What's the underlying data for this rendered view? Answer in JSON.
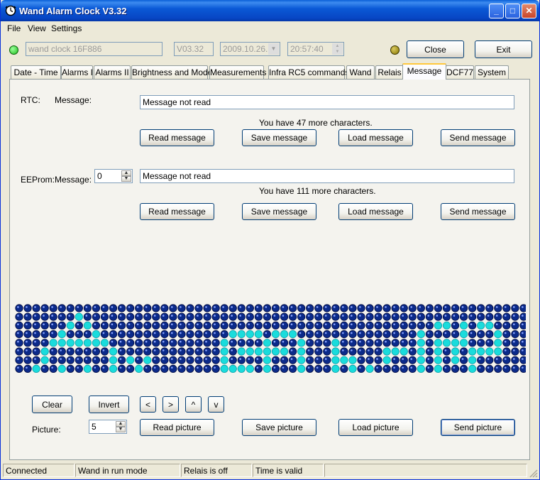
{
  "window": {
    "title": "Wand Alarm Clock V3.32",
    "minimize": "_",
    "maximize": "□",
    "close": "✕"
  },
  "menu": [
    "File",
    "View",
    "Settings"
  ],
  "top": {
    "device_name": "wand clock 16F886",
    "version": "V03.32",
    "date": "2009.10.26.",
    "time": "20:57:40",
    "close_label": "Close",
    "exit_label": "Exit",
    "led_left_color": "#1ec01e",
    "led_right_color": "#8a7a00"
  },
  "tabs": [
    "Date - Time",
    "Alarms I",
    "Alarms II",
    "Brightness and Mode",
    "Measurements",
    "Infra RC5 commands",
    "Wand",
    "Relais",
    "Message",
    "DCF77",
    "System"
  ],
  "active_tab": "Message",
  "rtc": {
    "label": "RTC:",
    "message_label": "Message:",
    "message": "Message not read",
    "chars_left": "You have 47 more characters.",
    "buttons": [
      "Read message",
      "Save message",
      "Load message",
      "Send message"
    ]
  },
  "eeprom": {
    "label": "EEProm:",
    "message_label": "Message:",
    "index": "0",
    "message": "Message not read",
    "chars_left": "You have 111 more characters.",
    "buttons": [
      "Read message",
      "Save message",
      "Load message",
      "Send message"
    ]
  },
  "matrix": {
    "cols": 60,
    "rows": 8,
    "on_color": "#19dcdc",
    "off_color": "#0b2a8a",
    "rows_on": [
      "........................................................................",
      ".......#....................................................",
      "......#.#........................................##.#.##....",
      ".....#...#...............####.###..............#....#...#...",
      "....#######.............#....#...#...#.........#.####...#...",
      "...#.......#............#.######.#...#.....###.#.#.#.####...",
      "...#.......#.#.#........#....#...#...###...#...#.#.#.#......",
      "..#..#..#..#..#.........####.#...#...#.#.#.....#.#...#......"
    ]
  },
  "controls": {
    "clear": "Clear",
    "invert": "Invert",
    "left": "<",
    "right": ">",
    "up": "^",
    "down": "v",
    "picture_label": "Picture:",
    "picture_index": "5",
    "read_picture": "Read picture",
    "save_picture": "Save picture",
    "load_picture": "Load picture",
    "send_picture": "Send picture"
  },
  "status": [
    "Connected",
    "Wand in run mode",
    "Relais is off",
    "Time is valid",
    ""
  ]
}
